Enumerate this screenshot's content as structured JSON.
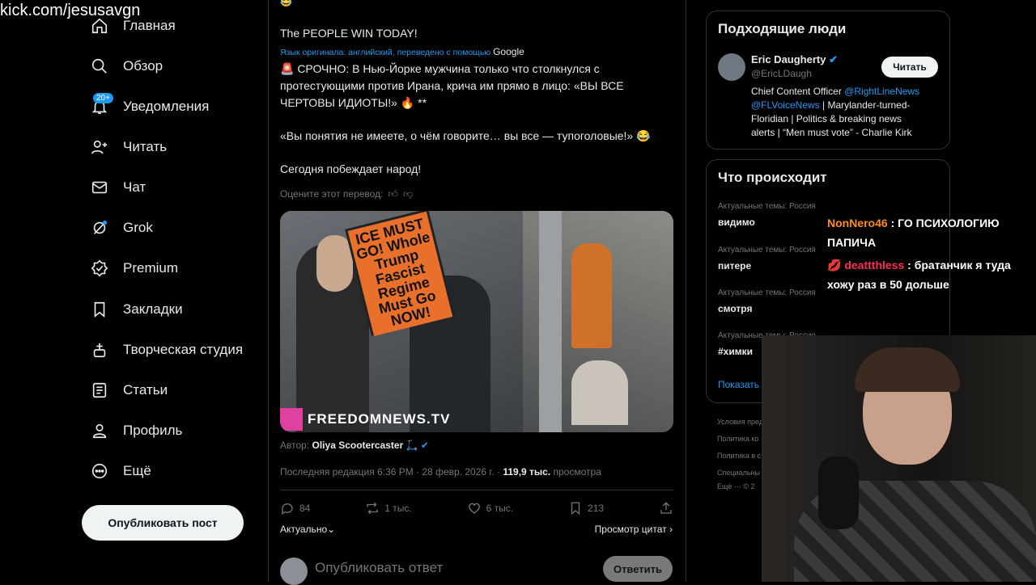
{
  "watermark": "kick.com/jesusavgn",
  "sidebar": {
    "items": [
      {
        "label": "Главная",
        "icon": "home-icon"
      },
      {
        "label": "Обзор",
        "icon": "search-icon"
      },
      {
        "label": "Уведомления",
        "icon": "bell-icon",
        "badge": "20+"
      },
      {
        "label": "Читать",
        "icon": "follow-icon"
      },
      {
        "label": "Чат",
        "icon": "mail-icon"
      },
      {
        "label": "Grok",
        "icon": "grok-icon"
      },
      {
        "label": "Premium",
        "icon": "verified-icon"
      },
      {
        "label": "Закладки",
        "icon": "bookmark-icon"
      },
      {
        "label": "Творческая студия",
        "icon": "studio-icon"
      },
      {
        "label": "Статьи",
        "icon": "articles-icon"
      },
      {
        "label": "Профиль",
        "icon": "profile-icon"
      },
      {
        "label": "Ещё",
        "icon": "more-icon"
      }
    ],
    "post_button": "Опубликовать пост"
  },
  "tweet": {
    "heading": "The PEOPLE WIN TODAY!",
    "translated_note": "Язык оригинала: английский, переведено с помощью",
    "translator": "Google",
    "body_line1": "🚨 СРОЧНО: В Нью-Йорке мужчина только что столкнулся с",
    "body_line2": "протестующими против Ирана, крича им прямо в лицо: «ВЫ ВСЕ",
    "body_line3": "ЧЕРТОВЫ ИДИОТЫ!» 🔥 **",
    "body_line4": "«Вы понятия не имеете, о чём говорите… вы все — тупоголовые!» 😂",
    "body_line5": "Сегодня побеждает народ!",
    "rate_translation": "Оцените этот перевод:",
    "sign_text": "ICE MUST GO! Whole Trump Fascist Regime Must Go NOW!",
    "media_watermark": "FREEDOMNEWS.TV",
    "author_label": "Автор:",
    "author_name": "Oliya Scootercaster 🛴",
    "meta_edit": "Последняя редакция 6:36 PM · 28 февр. 2026 г. ·",
    "views": "119,9 тыс.",
    "views_label": "просмотра",
    "replies": "84",
    "reposts": "1 тыс.",
    "likes": "6 тыс.",
    "bookmarks": "213",
    "sort_label": "Актуально",
    "quotes_label": "Просмотр цитат",
    "reply_placeholder": "Опубликовать ответ",
    "reply_button": "Ответить"
  },
  "suggested": {
    "title": "Подходящие люди",
    "name": "Eric Daugherty",
    "handle": "@EricLDaugh",
    "follow_button": "Читать",
    "bio_pre": "Chief Content Officer",
    "bio_link1": "@RightLineNews",
    "bio_link2": "@FLVoiceNews",
    "bio_rest1": "| Marylander-turned-",
    "bio_rest2": "Floridian | Politics & breaking news",
    "bio_rest3": "alerts | “Men must vote” - Charlie Kirk"
  },
  "trends": {
    "title": "Что происходит",
    "items": [
      {
        "category": "Актуальные темы: Россия",
        "name": "видимо"
      },
      {
        "category": "Актуальные темы: Россия",
        "name": "питере"
      },
      {
        "category": "Актуальные темы: Россия",
        "name": "смотря"
      },
      {
        "category": "Актуальные темы: Россия",
        "name": "#химки"
      }
    ],
    "show_more": "Показать"
  },
  "footer": [
    "Условия пред",
    "Политика ко",
    "Политика в с",
    "Специальны",
    "Ещё ··· © 2"
  ],
  "chat_overlay": [
    {
      "user": "NonNero46",
      "text": "ГО ПСИХОЛОГИЮ",
      "text2": "ПАПИЧА",
      "color": "#ff8c1a"
    },
    {
      "user": "deattthless",
      "text": "братанчик я туда",
      "text2": "хожу раз в 50 дольше",
      "color": "#ff2d55"
    }
  ]
}
